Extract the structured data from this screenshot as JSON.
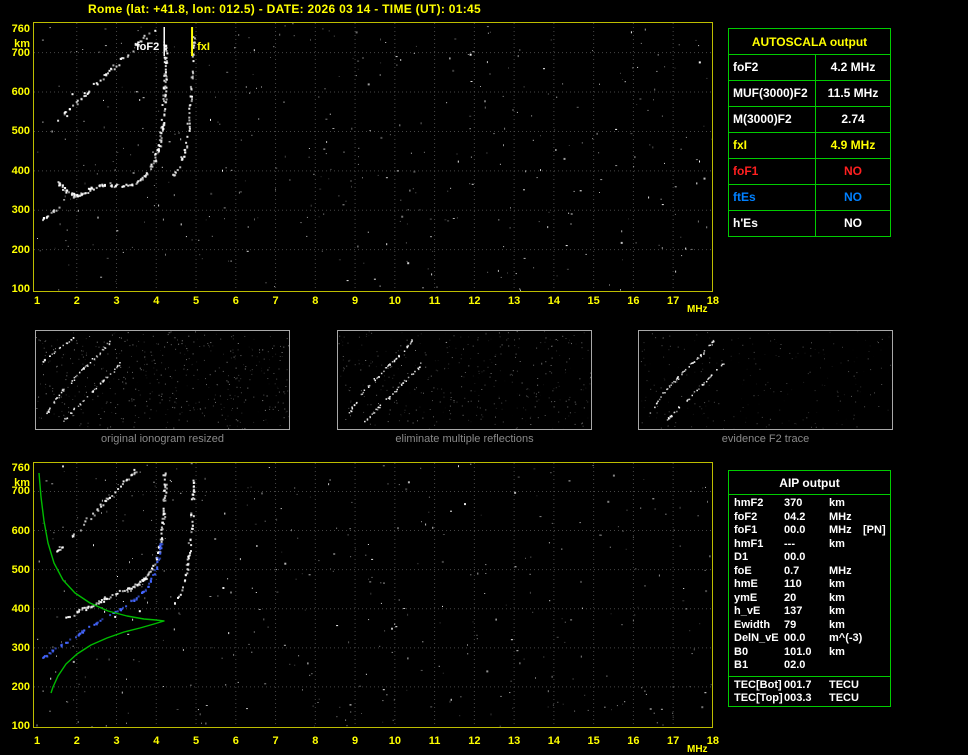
{
  "title": "Rome (lat: +41.8, lon: 012.5) - DATE: 2026 03 14 - TIME (UT): 01:45",
  "axes": {
    "y_unit": "km",
    "x_unit": "MHz",
    "y_ticks": [
      760,
      700,
      600,
      500,
      400,
      300,
      200,
      100
    ],
    "x_ticks": [
      1,
      2,
      3,
      4,
      5,
      6,
      7,
      8,
      9,
      10,
      11,
      12,
      13,
      14,
      15,
      16,
      17,
      18
    ]
  },
  "markers": [
    {
      "id": "foF2",
      "label": "foF2",
      "mhz": 4.2,
      "color": "#ffffff"
    },
    {
      "id": "fxI",
      "label": "fxI",
      "mhz": 4.9,
      "color": "#ffff00"
    }
  ],
  "autoscala": {
    "header": "AUTOSCALA output",
    "rows": [
      {
        "label": "foF2",
        "value": "4.2 MHz",
        "color": "#ffffff"
      },
      {
        "label": "MUF(3000)F2",
        "value": "11.5 MHz",
        "color": "#ffffff"
      },
      {
        "label": "M(3000)F2",
        "value": "2.74",
        "color": "#ffffff"
      },
      {
        "label": "fxI",
        "value": "4.9 MHz",
        "color": "#ffff00"
      },
      {
        "label": "foF1",
        "value": "NO",
        "color": "#ff2020"
      },
      {
        "label": "ftEs",
        "value": "NO",
        "color": "#0080ff"
      },
      {
        "label": "h'Es",
        "value": "NO",
        "color": "#ffffff"
      }
    ]
  },
  "aip": {
    "header": "AIP output",
    "rows": [
      {
        "label": "hmF2",
        "value": "370",
        "unit": "km"
      },
      {
        "label": "foF2",
        "value": "04.2",
        "unit": "MHz"
      },
      {
        "label": "foF1",
        "value": "00.0",
        "unit": "MHz",
        "extra": "[PN]"
      },
      {
        "label": "hmF1",
        "value": "---",
        "unit": "km"
      },
      {
        "label": "D1",
        "value": "00.0",
        "unit": ""
      },
      {
        "label": "foE",
        "value": "0.7",
        "unit": "MHz"
      },
      {
        "label": "hmE",
        "value": "110",
        "unit": "km"
      },
      {
        "label": "ymE",
        "value": "20",
        "unit": "km"
      },
      {
        "label": "h_vE",
        "value": "137",
        "unit": "km"
      },
      {
        "label": "Ewidth",
        "value": "79",
        "unit": "km"
      },
      {
        "label": "DelN_vE",
        "value": "00.0",
        "unit": "m^(-3)"
      },
      {
        "label": "B0",
        "value": "101.0",
        "unit": "km"
      },
      {
        "label": "B1",
        "value": "02.0",
        "unit": ""
      }
    ],
    "tec_rows": [
      {
        "label": "TEC[Bot]",
        "value": "001.7",
        "unit": "TECU"
      },
      {
        "label": "TEC[Top]",
        "value": "003.3",
        "unit": "TECU"
      }
    ]
  },
  "thumbnails": [
    {
      "caption": "original ionogram resized"
    },
    {
      "caption": "eliminate multiple reflections"
    },
    {
      "caption": "evidence F2 trace"
    }
  ],
  "chart_data": {
    "type": "scatter",
    "description": "Ionogram: virtual height (km) vs sounding frequency (MHz), O/X echo traces plus restored trace (blue) and electron density profile (green) in lower panel",
    "x_range": [
      1,
      18
    ],
    "y_range": [
      100,
      760
    ],
    "xlabel": "MHz",
    "ylabel": "km",
    "grid": true,
    "scaled_parameters": {
      "foF2_MHz": 4.2,
      "MUF3000F2_MHz": 11.5,
      "M3000F2": 2.74,
      "fxI_MHz": 4.9,
      "hmF2_km": 370,
      "foF1": null,
      "ftEs": null,
      "hEs": null
    }
  },
  "colors": {
    "accent_yellow": "#ffff00",
    "plot_border": "#bdbd00",
    "grid": "#464646",
    "table_green": "#00cc00",
    "profile_green": "#00bb00",
    "trace_blue": "#4466ff",
    "caption_gray": "#8a8a8a",
    "no_red": "#ff2020",
    "es_blue": "#0080ff"
  },
  "traces": {
    "top": {
      "noise": 380,
      "paths": [
        {
          "pts": [
            [
              22,
              98
            ],
            [
              70,
              52
            ],
            [
              119,
              5
            ]
          ],
          "n": 55,
          "jitter": 2.5,
          "color": "#ffffff",
          "size": 2
        },
        {
          "pts": [
            [
              8,
              196
            ],
            [
              16,
              190
            ],
            [
              24,
              184
            ]
          ],
          "n": 14,
          "jitter": 1.6,
          "color": "#ffffff",
          "size": 2
        },
        {
          "pts": [
            [
              24,
              158
            ],
            [
              31,
              167
            ],
            [
              40,
              172
            ],
            [
              50,
              170
            ],
            [
              57,
              164
            ]
          ],
          "n": 45,
          "jitter": 2.0,
          "color": "#ffffff",
          "size": 2
        },
        {
          "pts": [
            [
              57,
              164
            ],
            [
              72,
              161
            ],
            [
              88,
              163
            ],
            [
              100,
              160
            ],
            [
              108,
              154
            ],
            [
              115,
              146
            ],
            [
              121,
              135
            ],
            [
              125,
              120
            ],
            [
              128,
              100
            ],
            [
              130,
              75
            ],
            [
              131,
              48
            ],
            [
              131,
              18
            ]
          ],
          "n": 135,
          "jitter": 2.2,
          "color": "#ffffff",
          "size": 2
        },
        {
          "pts": [
            [
              138,
              152
            ],
            [
              145,
              141
            ],
            [
              150,
              128
            ],
            [
              153,
              112
            ],
            [
              155,
              92
            ],
            [
              157,
              66
            ],
            [
              158,
              38
            ],
            [
              159,
              12
            ]
          ],
          "n": 60,
          "jitter": 1.8,
          "color": "#ffffff",
          "size": 2
        }
      ]
    },
    "bottom": {
      "noise": 380,
      "paths": [
        {
          "pts": [
            [
              22,
              88
            ],
            [
              62,
              47
            ],
            [
              102,
              6
            ]
          ],
          "n": 45,
          "jitter": 2.2,
          "color": "#ffffff",
          "size": 2
        },
        {
          "pts": [
            [
              30,
              155
            ],
            [
              45,
              147
            ],
            [
              60,
              140
            ],
            [
              75,
              133
            ],
            [
              90,
              127
            ],
            [
              103,
              121
            ],
            [
              112,
              113
            ],
            [
              119,
              103
            ],
            [
              124,
              90
            ],
            [
              127,
              72
            ],
            [
              129,
              50
            ],
            [
              130,
              28
            ],
            [
              130,
              8
            ]
          ],
          "n": 135,
          "jitter": 2.2,
          "color": "#ffffff",
          "size": 2
        },
        {
          "pts": [
            [
              140,
              140
            ],
            [
              147,
              126
            ],
            [
              152,
              108
            ],
            [
              155,
              86
            ],
            [
              157,
              60
            ],
            [
              158,
              34
            ],
            [
              159,
              12
            ]
          ],
          "n": 55,
          "jitter": 1.8,
          "color": "#ffffff",
          "size": 2
        },
        {
          "pts": [
            [
              6,
              196
            ],
            [
              18,
              187
            ],
            [
              32,
              178
            ],
            [
              46,
              169
            ],
            [
              60,
              160
            ],
            [
              74,
              152
            ],
            [
              88,
              144
            ],
            [
              100,
              136
            ],
            [
              110,
              127
            ],
            [
              117,
              116
            ],
            [
              122,
              103
            ],
            [
              125,
              90
            ],
            [
              127,
              78
            ]
          ],
          "n": 95,
          "jitter": 1.6,
          "color": "#4466ff",
          "size": 2
        }
      ],
      "profile": [
        [
          5,
          10
        ],
        [
          7,
          34
        ],
        [
          10,
          58
        ],
        [
          14,
          80
        ],
        [
          20,
          100
        ],
        [
          29,
          117
        ],
        [
          41,
          130
        ],
        [
          56,
          140
        ],
        [
          74,
          148
        ],
        [
          93,
          153
        ],
        [
          110,
          156
        ],
        [
          122,
          157
        ],
        [
          130,
          158
        ],
        [
          120,
          161
        ],
        [
          106,
          165
        ],
        [
          90,
          169
        ],
        [
          73,
          175
        ],
        [
          57,
          182
        ],
        [
          43,
          191
        ],
        [
          32,
          201
        ],
        [
          24,
          213
        ],
        [
          19,
          224
        ],
        [
          17,
          230
        ]
      ]
    },
    "thumb_arcs": {
      "a1": {
        "pts": [
          [
            10,
            82
          ],
          [
            18,
            70
          ],
          [
            27,
            58
          ],
          [
            37,
            47
          ],
          [
            47,
            37
          ],
          [
            57,
            28
          ],
          [
            65,
            20
          ],
          [
            71,
            13
          ],
          [
            75,
            8
          ]
        ],
        "n": 55,
        "jitter": 1.4,
        "color": "#ffffff",
        "size": 1.5
      },
      "a2": {
        "pts": [
          [
            26,
            90
          ],
          [
            36,
            80
          ],
          [
            47,
            69
          ],
          [
            58,
            58
          ],
          [
            68,
            48
          ],
          [
            77,
            39
          ],
          [
            84,
            31
          ]
        ],
        "n": 40,
        "jitter": 1.4,
        "color": "#ffffff",
        "size": 1.5
      },
      "streak": {
        "pts": [
          [
            4,
            32
          ],
          [
            22,
            17
          ],
          [
            40,
            4
          ]
        ],
        "n": 22,
        "jitter": 1.1,
        "color": "#ffffff",
        "size": 1.5
      }
    },
    "thumbs": [
      {
        "noise": 500,
        "bright": 0.55,
        "paths": [
          "a1",
          "a2",
          "streak"
        ]
      },
      {
        "noise": 400,
        "bright": 0.5,
        "paths": [
          "a1",
          "a2"
        ]
      },
      {
        "noise": 250,
        "bright": 0.35,
        "paths": [
          "a1",
          "a2"
        ]
      }
    ]
  }
}
